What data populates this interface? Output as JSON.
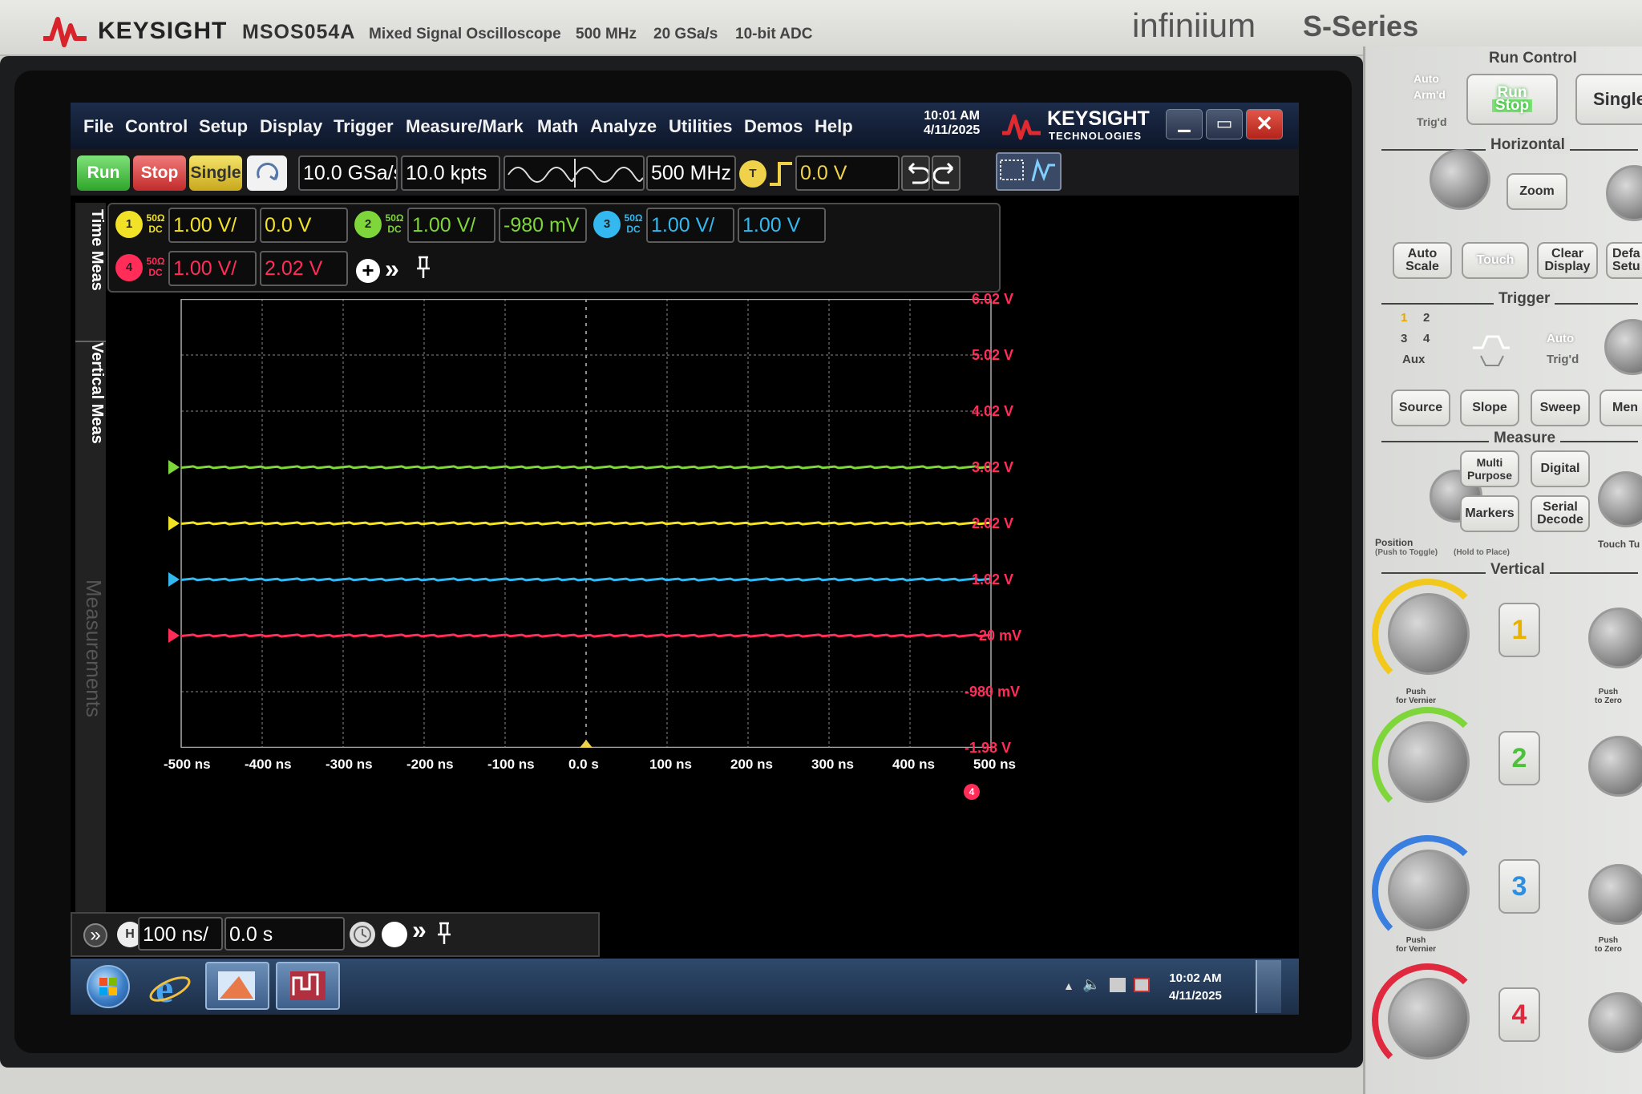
{
  "instrument": {
    "brand": "KEYSIGHT",
    "model": "MSOS054A",
    "description": "Mixed Signal Oscilloscope",
    "specs": [
      "500 MHz",
      "20 GSa/s",
      "10-bit ADC"
    ],
    "series_logo": "infiniium",
    "series_name": "S-Series"
  },
  "window": {
    "menu": [
      "File",
      "Control",
      "Setup",
      "Display",
      "Trigger",
      "Measure/Mark",
      "Math",
      "Analyze",
      "Utilities",
      "Demos",
      "Help"
    ],
    "clock_time": "10:01 AM",
    "clock_date": "4/11/2025",
    "logo_brand": "KEYSIGHT",
    "logo_sub": "TECHNOLOGIES",
    "minimize": "▁",
    "maximize": "▭",
    "close": "✕"
  },
  "toolbar": {
    "run": "Run",
    "stop": "Stop",
    "single": "Single",
    "sample_rate": "10.0 GSa/s",
    "memory_depth": "10.0 kpts",
    "bandwidth": "500 MHz",
    "trigger_badge": "T",
    "trigger_level": "0.0 V"
  },
  "channels": [
    {
      "id": "1",
      "coupling": "50Ω DC",
      "scale": "1.00 V/",
      "offset": "0.0 V",
      "color": "#f2e227"
    },
    {
      "id": "2",
      "coupling": "50Ω DC",
      "scale": "1.00 V/",
      "offset": "-980 mV",
      "color": "#7fd63a"
    },
    {
      "id": "3",
      "coupling": "50Ω DC",
      "scale": "1.00 V/",
      "offset": "1.00 V",
      "color": "#34b8f0"
    },
    {
      "id": "4",
      "coupling": "50Ω DC",
      "scale": "1.00 V/",
      "offset": "2.02 V",
      "color": "#ff2d58"
    }
  ],
  "side_tabs": [
    "Time Meas",
    "Vertical Meas",
    "Measurements"
  ],
  "waveform": {
    "volt_labels": [
      "6.02 V",
      "5.02 V",
      "4.02 V",
      "3.02 V",
      "2.02 V",
      "1.02 V",
      "20 mV",
      "-980 mV",
      "-1.98 V"
    ],
    "time_labels": [
      "-500 ns",
      "-400 ns",
      "-300 ns",
      "-200 ns",
      "-100 ns",
      "0.0 s",
      "100 ns",
      "200 ns",
      "300 ns",
      "400 ns",
      "500 ns"
    ],
    "traces": [
      {
        "channel": "2",
        "level_div": 3.0,
        "color": "#7fd63a"
      },
      {
        "channel": "1",
        "level_div": 2.0,
        "color": "#f2e227"
      },
      {
        "channel": "3",
        "level_div": 1.0,
        "color": "#34b8f0"
      },
      {
        "channel": "4",
        "level_div": 0.0,
        "color": "#ff2d58"
      }
    ]
  },
  "horizontal": {
    "scale": "100 ns/",
    "position": "0.0 s"
  },
  "taskbar": {
    "time": "10:02 AM",
    "date": "4/11/2025"
  },
  "panel": {
    "run_control": "Run Control",
    "auto_arm": "Auto\nArm'd",
    "trigd": "Trig'd",
    "run": "Run",
    "stop": "Stop",
    "single": "Single",
    "horizontal": "Horizontal",
    "zoom": "Zoom",
    "auto_scale": "Auto\nScale",
    "touch": "Touch",
    "clear_display": "Clear\nDisplay",
    "default_setup": "Defa\nSetu",
    "trigger": "Trigger",
    "aux": "Aux",
    "auto": "Auto",
    "trigd2": "Trig'd",
    "source": "Source",
    "slope": "Slope",
    "sweep": "Sweep",
    "menu": "Men",
    "measure": "Measure",
    "multi_purpose": "Multi\nPurpose",
    "digital": "Digital",
    "markers": "Markers",
    "serial_decode": "Serial\nDecode",
    "position": "Position",
    "push_toggle": "(Push to Toggle)",
    "hold_place": "(Hold to Place)",
    "touch_tu": "Touch Tu",
    "vertical": "Vertical",
    "push_vernier": "Push\nfor Vernier",
    "push_zero": "Push\nto Zero",
    "ch_buttons": [
      "1",
      "2",
      "3",
      "4"
    ]
  }
}
